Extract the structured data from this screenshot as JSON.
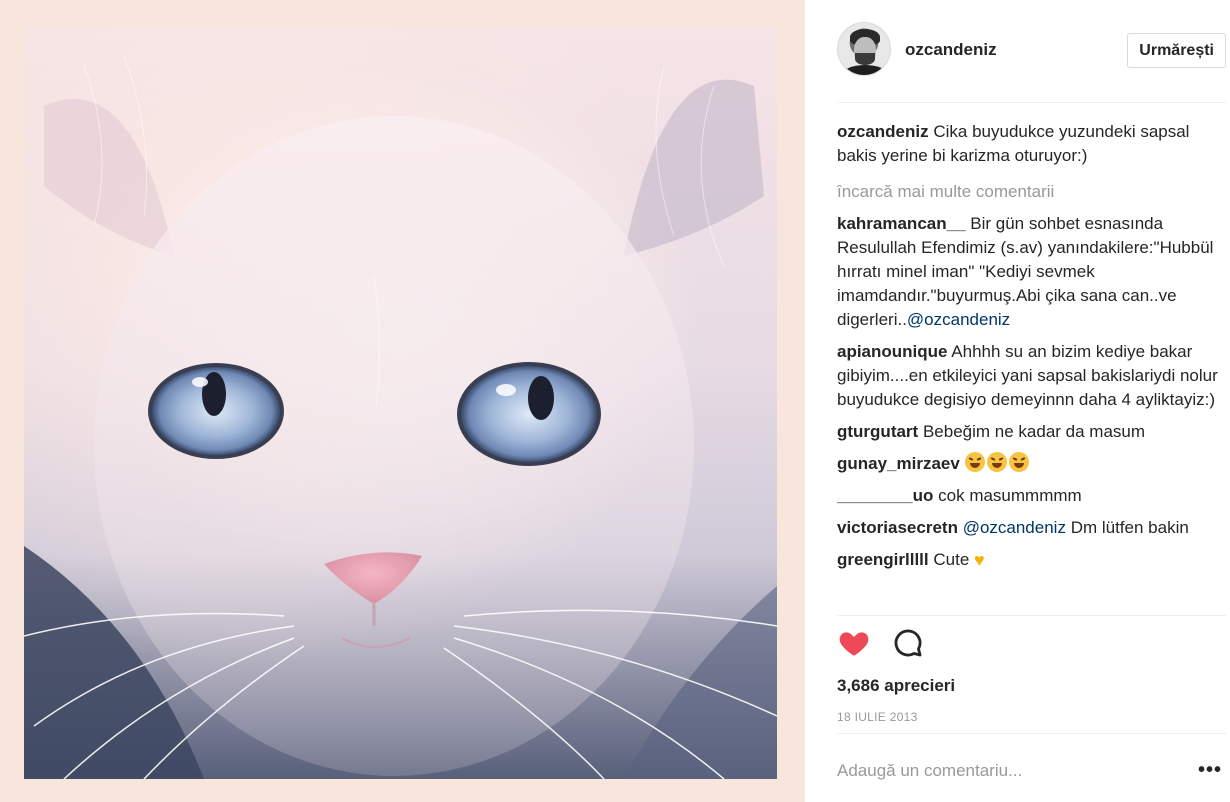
{
  "post": {
    "image_alt": "white kitten with blue eyes",
    "author": "ozcandeniz",
    "follow_label": "Urmărești"
  },
  "caption": {
    "user": "ozcandeniz",
    "text": "Cika buyudukce yuzundeki sapsal bakis yerine bi karizma oturuyor:)"
  },
  "load_more": "încarcă mai multe comentarii",
  "comments": [
    {
      "user": "kahramancan__",
      "text": "Bir gün sohbet esnasında Resulullah Efendimiz (s.av) yanındakilere:\"Hubbül hırratı minel iman\" \"Kediyi sevmek imamdandır.\"buyurmuş.Abi çika sana can..ve digerleri..",
      "mention": "@ozcandeniz"
    },
    {
      "user": "apianounique",
      "text": "Ahhhh su an bizim kediye bakar gibiyim....en etkileyici yani sapsal bakislariydi nolur buyudukce degisiyo demeyinnn daha 4 ayliktayiz:)"
    },
    {
      "user": "gturgutart",
      "text": "Bebeğim ne kadar da masum"
    },
    {
      "user": "gunay_mirzaev",
      "emoji": "tired-face-emoji x3"
    },
    {
      "user": "________uo",
      "text": "cok masummmmm"
    },
    {
      "user": "victoriasecretn",
      "mention": "@ozcandeniz",
      "text": "Dm lütfen bakin"
    },
    {
      "user": "greengirlllll",
      "text": "Cute",
      "emoji": "yellow-heart-emoji"
    }
  ],
  "likes": "3,686 aprecieri",
  "date": "18 IULIE 2013",
  "add_comment_placeholder": "Adaugă un comentariu...",
  "more_label": "•••",
  "icons": {
    "like": "heart-icon",
    "like_color": "#ed4956",
    "comment": "comment-bubble-icon",
    "more": "more-options-icon"
  }
}
